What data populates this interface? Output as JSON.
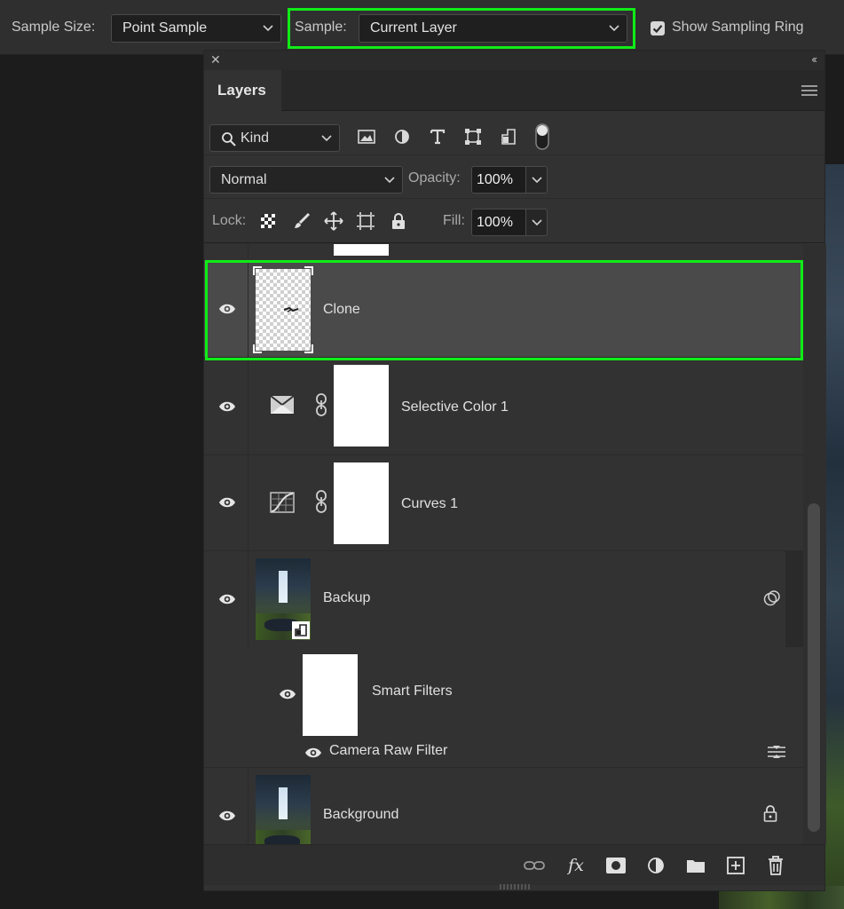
{
  "options_bar": {
    "sample_size_label": "Sample Size:",
    "sample_size_value": "Point Sample",
    "sample_label": "Sample:",
    "sample_value": "Current Layer",
    "show_sampling_ring_label": "Show Sampling Ring",
    "show_sampling_ring_checked": true
  },
  "layers_panel": {
    "tab_label": "Layers",
    "filter_kind_label": "Kind",
    "blend_mode": "Normal",
    "opacity_label": "Opacity:",
    "opacity_value": "100%",
    "lock_label": "Lock:",
    "fill_label": "Fill:",
    "fill_value": "100%",
    "layers": [
      {
        "name": "Clone",
        "selected": true
      },
      {
        "name": "Selective Color 1"
      },
      {
        "name": "Curves 1"
      },
      {
        "name": "Backup",
        "smart_filters_label": "Smart Filters",
        "filter_name": "Camera Raw Filter"
      },
      {
        "name": "Background",
        "locked": true
      }
    ]
  },
  "colors": {
    "highlight": "#10ec17",
    "panel_bg": "#323232",
    "selected_row": "#4a4a4a"
  }
}
